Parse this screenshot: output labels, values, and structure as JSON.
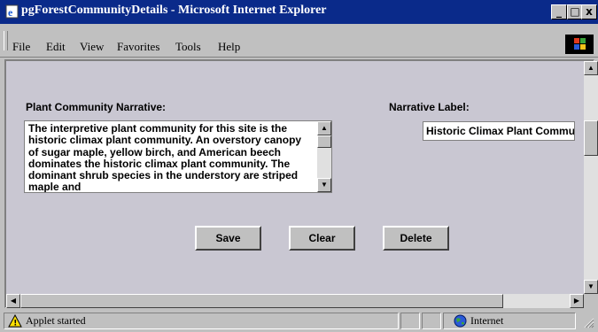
{
  "window": {
    "title": "pgForestCommunityDetails - Microsoft Internet Explorer"
  },
  "window_buttons": {
    "minimize": "_",
    "maximize": "□",
    "close": "x"
  },
  "menu": [
    {
      "label": "File"
    },
    {
      "label": "Edit"
    },
    {
      "label": "View"
    },
    {
      "label": "Favorites"
    },
    {
      "label": "Tools"
    },
    {
      "label": "Help"
    }
  ],
  "form": {
    "narrative_heading": "Plant Community Narrative:",
    "narrative_text": "The interpretive plant community for this site is the historic climax plant community.  An overstory canopy of sugar maple, yellow birch, and American beech dominates the historic climax plant community.  The dominant shrub species in the understory are striped maple and",
    "label_heading": "Narrative Label:",
    "label_value": "Historic Climax Plant Community"
  },
  "buttons": {
    "save": "Save",
    "clear": "Clear",
    "delete": "Delete"
  },
  "scroll_glyphs": {
    "up": "▲",
    "down": "▼",
    "left": "◀",
    "right": "▶"
  },
  "status": {
    "message": "Applet started",
    "zone": "Internet"
  }
}
